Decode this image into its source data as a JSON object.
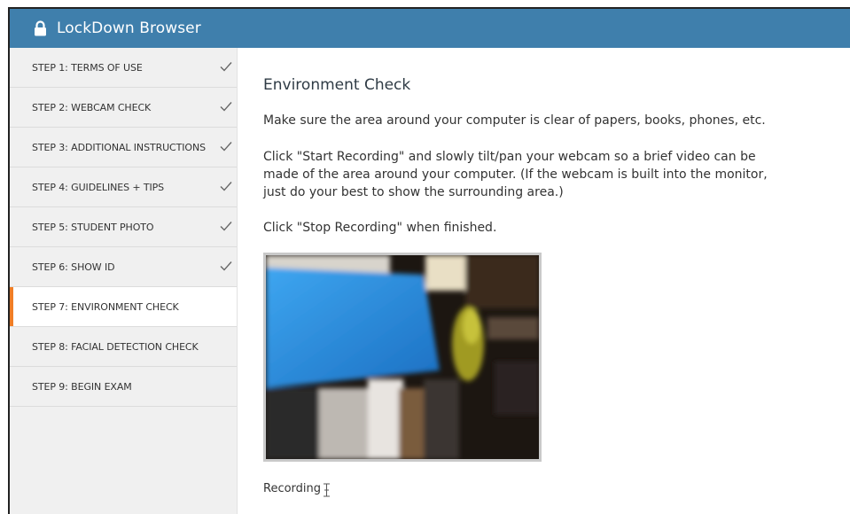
{
  "window": {
    "title": "LockDown Browser",
    "lock_icon": "lock-icon"
  },
  "sidebar": {
    "items": [
      {
        "label": "STEP 1: TERMS OF USE",
        "completed": true
      },
      {
        "label": "STEP 2: WEBCAM CHECK",
        "completed": true
      },
      {
        "label": "STEP 3: ADDITIONAL INSTRUCTIONS",
        "completed": true
      },
      {
        "label": "STEP 4: GUIDELINES + TIPS",
        "completed": true
      },
      {
        "label": "STEP 5: STUDENT PHOTO",
        "completed": true
      },
      {
        "label": "STEP 6: SHOW ID",
        "completed": true
      },
      {
        "label": "STEP 7: ENVIRONMENT CHECK",
        "completed": false,
        "active": true
      },
      {
        "label": "STEP 8: FACIAL DETECTION CHECK",
        "completed": false
      },
      {
        "label": "STEP 9: BEGIN EXAM",
        "completed": false
      }
    ]
  },
  "main": {
    "heading": "Environment Check",
    "paragraph1": "Make sure the area around your computer is clear of papers, books, phones, etc.",
    "paragraph2": "Click \"Start Recording\" and slowly tilt/pan your webcam so a brief video can be made of the area around your computer. (If the webcam is built into the monitor, just do your best to show the surrounding area.)",
    "paragraph3": "Click \"Stop Recording\" when finished.",
    "status": "Recording"
  },
  "colors": {
    "titlebar": "#3f7fac",
    "active_accent": "#f07e26",
    "sidebar_bg": "#f0f0f0"
  }
}
